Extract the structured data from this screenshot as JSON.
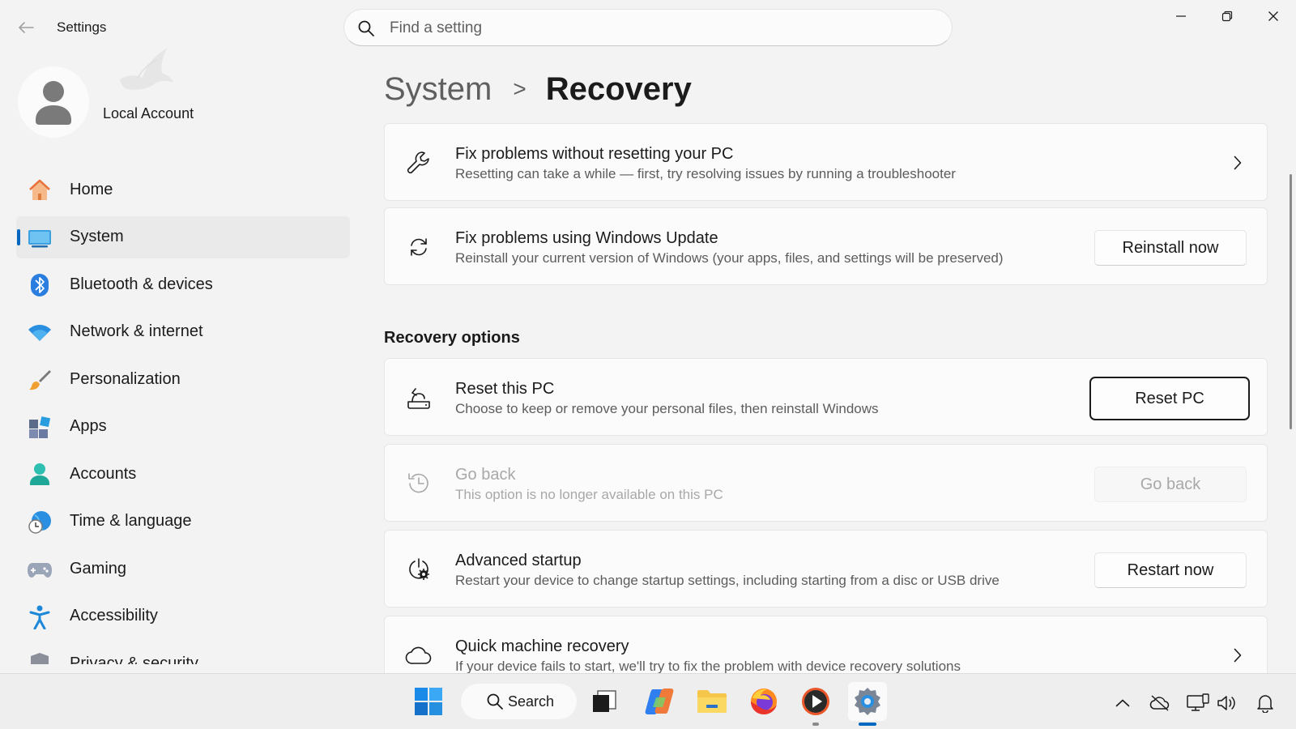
{
  "window": {
    "title": "Settings",
    "search_placeholder": "Find a setting"
  },
  "account": {
    "name": "Local Account"
  },
  "sidebar": {
    "items": [
      {
        "label": "Home",
        "icon": "home-icon"
      },
      {
        "label": "System",
        "icon": "system-icon",
        "active": true
      },
      {
        "label": "Bluetooth & devices",
        "icon": "bluetooth-icon"
      },
      {
        "label": "Network & internet",
        "icon": "wifi-icon"
      },
      {
        "label": "Personalization",
        "icon": "brush-icon"
      },
      {
        "label": "Apps",
        "icon": "apps-icon"
      },
      {
        "label": "Accounts",
        "icon": "person-icon"
      },
      {
        "label": "Time & language",
        "icon": "globe-clock-icon"
      },
      {
        "label": "Gaming",
        "icon": "gamepad-icon"
      },
      {
        "label": "Accessibility",
        "icon": "accessibility-icon"
      },
      {
        "label": "Privacy & security",
        "icon": "shield-icon"
      }
    ]
  },
  "breadcrumb": {
    "parent": "System",
    "separator": ">",
    "current": "Recovery"
  },
  "cards": {
    "fix_without_reset": {
      "title": "Fix problems without resetting your PC",
      "desc": "Resetting can take a while — first, try resolving issues by running a troubleshooter"
    },
    "windows_update": {
      "title": "Fix problems using Windows Update",
      "desc": "Reinstall your current version of Windows (your apps, files, and settings will be preserved)",
      "button": "Reinstall now"
    }
  },
  "recovery_options": {
    "heading": "Recovery options",
    "reset_pc": {
      "title": "Reset this PC",
      "desc": "Choose to keep or remove your personal files, then reinstall Windows",
      "button": "Reset PC"
    },
    "go_back": {
      "title": "Go back",
      "desc": "This option is no longer available on this PC",
      "button": "Go back",
      "disabled": true
    },
    "advanced_startup": {
      "title": "Advanced startup",
      "desc": "Restart your device to change startup settings, including starting from a disc or USB drive",
      "button": "Restart now"
    },
    "quick_recovery": {
      "title": "Quick machine recovery",
      "desc": "If your device fails to start, we'll try to fix the problem with device recovery solutions"
    }
  },
  "taskbar": {
    "search_label": "Search",
    "apps": [
      "start-icon",
      "task-view-icon",
      "copilot-icon",
      "file-explorer-icon",
      "firefox-icon",
      "media-player-icon",
      "settings-icon"
    ],
    "tray": [
      "show-hidden-icons",
      "onedrive-offline-icon",
      "display-network-icon",
      "volume-icon",
      "notification-bell-icon"
    ]
  },
  "colors": {
    "accent": "#0067c0",
    "background": "#f3f3f3",
    "card": "#fbfbfb"
  }
}
